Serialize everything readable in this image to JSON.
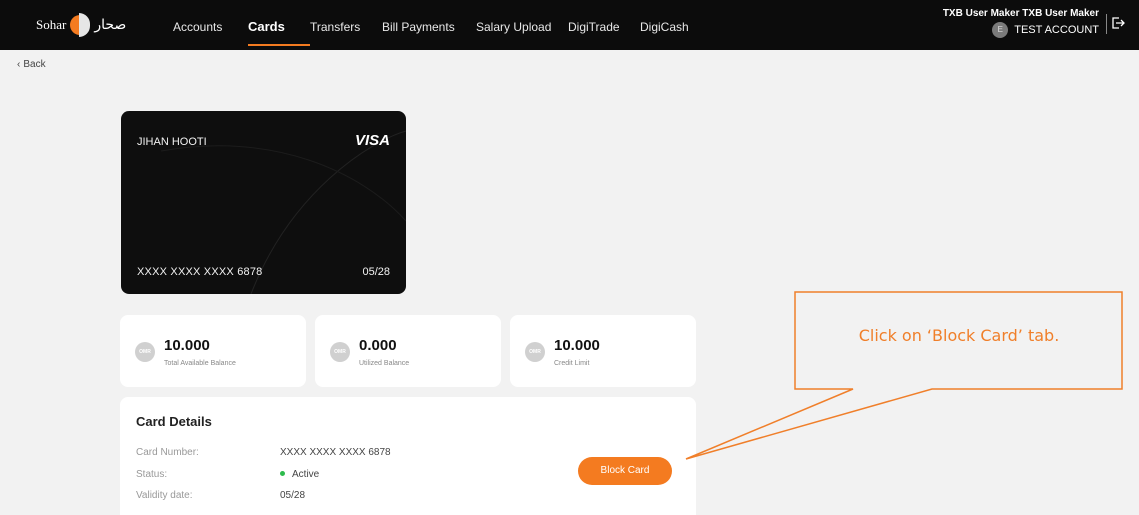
{
  "header": {
    "logo_text_en": "Sohar",
    "logo_text_ar": "صحار",
    "nav": [
      {
        "label": "Accounts",
        "active": false
      },
      {
        "label": "Cards",
        "active": true
      },
      {
        "label": "Transfers",
        "active": false
      },
      {
        "label": "Bill Payments",
        "active": false
      },
      {
        "label": "Salary Upload",
        "active": false
      },
      {
        "label": "DigiTrade",
        "active": false
      },
      {
        "label": "DigiCash",
        "active": false
      }
    ],
    "user_name": "TXB User Maker TXB User Maker",
    "account_name": "TEST ACCOUNT",
    "account_initials": "E",
    "icons": {
      "account": "building-icon",
      "logout": "logout-icon"
    }
  },
  "back_label": "Back",
  "card": {
    "holder": "JIHAN HOOTI",
    "brand": "VISA",
    "number": "XXXX XXXX XXXX 6878",
    "expiry": "05/28"
  },
  "balances": [
    {
      "currency": "OMR",
      "amount": "10.000",
      "label": "Total Available Balance"
    },
    {
      "currency": "OMR",
      "amount": "0.000",
      "label": "Utilized Balance"
    },
    {
      "currency": "OMR",
      "amount": "10.000",
      "label": "Credit Limit"
    }
  ],
  "details": {
    "title": "Card Details",
    "rows": [
      {
        "label": "Card Number:",
        "value": "XXXX XXXX XXXX 6878"
      },
      {
        "label": "Status:",
        "value": "Active"
      },
      {
        "label": "Validity date:",
        "value": "05/28"
      }
    ],
    "block_button": "Block Card"
  },
  "callout": {
    "text": "Click on ‘Block Card’ tab."
  },
  "colors": {
    "accent": "#f47b20",
    "topbar": "#0c0c0c",
    "status_active": "#2dbb4c",
    "callout_border": "#f07f2a"
  }
}
